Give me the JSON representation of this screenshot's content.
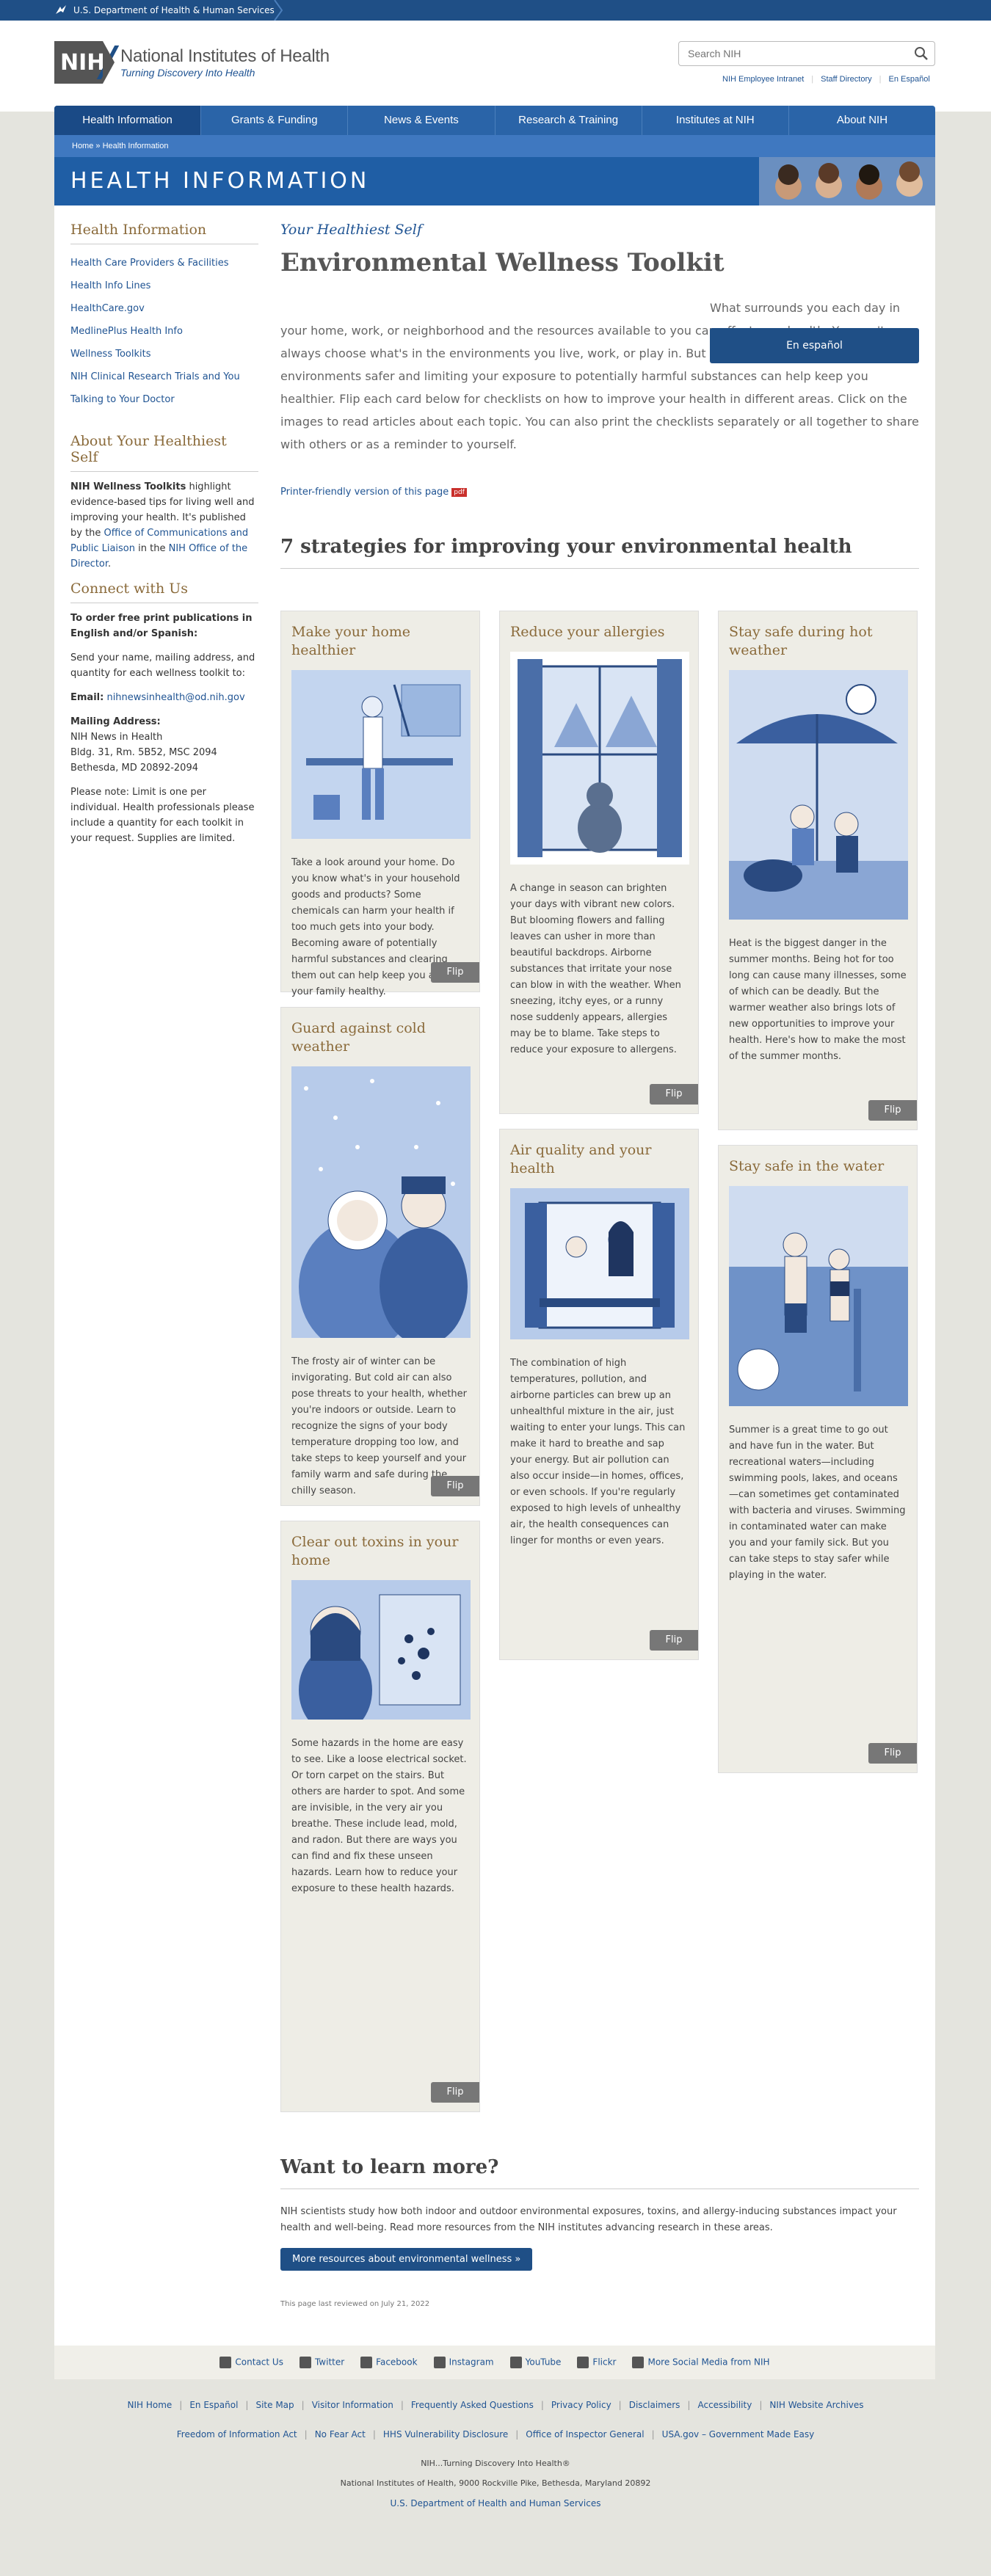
{
  "hhs": {
    "label": "U.S. Department of Health & Human Services"
  },
  "logo": {
    "abbr": "NIH",
    "name": "National Institutes of Health",
    "tagline": "Turning Discovery Into Health"
  },
  "search": {
    "placeholder": "Search NIH"
  },
  "toplinks": [
    "NIH Employee Intranet",
    "Staff Directory",
    "En Español"
  ],
  "nav": [
    "Health Information",
    "Grants & Funding",
    "News & Events",
    "Research & Training",
    "Institutes at NIH",
    "About NIH"
  ],
  "breadcrumb": "Home » Health Information",
  "banner": "HEALTH INFORMATION",
  "sidebar": {
    "heading1": "Health Information",
    "links": [
      "Health Care Providers & Facilities",
      "Health Info Lines",
      "HealthCare.gov",
      "MedlinePlus Health Info",
      "Wellness Toolkits",
      "NIH Clinical Research Trials and You",
      "Talking to Your Doctor"
    ],
    "heading2": "About Your Healthiest Self",
    "about_bold": "NIH Wellness Toolkits",
    "about_text": " highlight evidence-based tips for living well and improving your health. It's published by the ",
    "about_link1": "Office of Communications and Public Liaison",
    "about_mid": " in the ",
    "about_link2": "NIH Office of the Director",
    "about_end": ".",
    "heading3": "Connect with Us",
    "order_bold": "To order free print publications in English and/or Spanish:",
    "order_text": "Send your name, mailing address, and quantity for each wellness toolkit to:",
    "email_label": "Email:",
    "email": "nihnewsinhealth@od.nih.gov",
    "mail_label": "Mailing Address:",
    "mail_lines": [
      "NIH News in Health",
      "Bldg. 31, Rm. 5B52, MSC 2094",
      "Bethesda, MD 20892-2094"
    ],
    "note": "Please note: Limit is one per individual. Health professionals please include a quantity for each toolkit in your request. Supplies are limited."
  },
  "main": {
    "eyebrow": "Your Healthiest Self",
    "title": "Environmental Wellness Toolkit",
    "intro": "What surrounds you each day in your home, work, or neighborhood and the resources available to you can affect your health. You can't always choose what's in the environments you live, work, or play in. But taking small steps to make your environments safer and limiting your exposure to potentially harmful substances can help keep you healthier. Flip each card below for checklists on how to improve your health in different areas. Click on the images to read articles about each topic. You can also print the checklists separately or all together to share with others or as a reminder to yourself.",
    "espanol": "En español",
    "printer": "Printer-friendly version of this page",
    "pdf": "pdf",
    "section": "7 strategies for improving your environmental health",
    "flip": "Flip"
  },
  "cards": [
    {
      "title": "Make your home healthier",
      "text": "Take a look around your home. Do you know what's in your household goods and products? Some chemicals can harm your health if too much gets into your body. Becoming aware of potentially harmful substances and clearing them out can help keep you and your family healthy."
    },
    {
      "title": "Reduce your allergies",
      "text": "A change in season can brighten your days with vibrant new colors. But blooming flowers and falling leaves can usher in more than beautiful backdrops. Airborne substances that irritate your nose can blow in with the weather. When sneezing, itchy eyes, or a runny nose suddenly appears, allergies may be to blame. Take steps to reduce your exposure to allergens."
    },
    {
      "title": "Stay safe during hot weather",
      "text": "Heat is the biggest danger in the summer months. Being hot for too long can cause many illnesses, some of which can be deadly. But the warmer weather also brings lots of new opportunities to improve your health. Here's how to make the most of the summer months."
    },
    {
      "title": "Guard against cold weather",
      "text": "The frosty air of winter can be invigorating. But cold air can also pose threats to your health, whether you're indoors or outside. Learn to recognize the signs of your body temperature dropping too low, and take steps to keep yourself and your family warm and safe during the chilly season."
    },
    {
      "title": "Air quality and your health",
      "text": "The combination of high temperatures, pollution, and airborne particles can brew up an unhealthful mixture in the air, just waiting to enter your lungs. This can make it hard to breathe and sap your energy. But air pollution can also occur inside—in homes, offices, or even schools. If you're regularly exposed to high levels of unhealthy air, the health consequences can linger for months or even years."
    },
    {
      "title": "Stay safe in the water",
      "text": "Summer is a great time to go out and have fun in the water. But recreational waters—including swimming pools, lakes, and oceans—can sometimes get contaminated with bacteria and viruses. Swimming in contaminated water can make you and your family sick. But you can take steps to stay safer while playing in the water."
    },
    {
      "title": "Clear out toxins in your home",
      "text": "Some hazards in the home are easy to see. Like a loose electrical socket. Or torn carpet on the stairs. But others are harder to spot. And some are invisible, in the very air you breathe. These include lead, mold, and radon. But there are ways you can find and fix these unseen hazards. Learn how to reduce your exposure to these health hazards."
    }
  ],
  "learn": {
    "heading": "Want to learn more?",
    "text": "NIH scientists study how both indoor and outdoor environmental exposures, toxins, and allergy-inducing substances impact your health and well-being. Read more resources from the NIH institutes advancing research in these areas.",
    "button": "More resources about environmental wellness »",
    "reviewed": "This page last reviewed on July 21, 2022"
  },
  "social": [
    "Contact Us",
    "Twitter",
    "Facebook",
    "Instagram",
    "YouTube",
    "Flickr",
    "More Social Media from NIH"
  ],
  "footer": {
    "row1": [
      "NIH Home",
      "En Español",
      "Site Map",
      "Visitor Information",
      "Frequently Asked Questions",
      "Privacy Policy",
      "Disclaimers",
      "Accessibility",
      "NIH Website Archives"
    ],
    "row2": [
      "Freedom of Information Act",
      "No Fear Act",
      "HHS Vulnerability Disclosure",
      "Office of Inspector General",
      "USA.gov – Government Made Easy"
    ],
    "tag": "NIH...Turning Discovery Into Health®",
    "address": "National Institutes of Health, 9000 Rockville Pike, Bethesda, Maryland 20892",
    "hhs": "U.S. Department of Health and Human Services"
  }
}
